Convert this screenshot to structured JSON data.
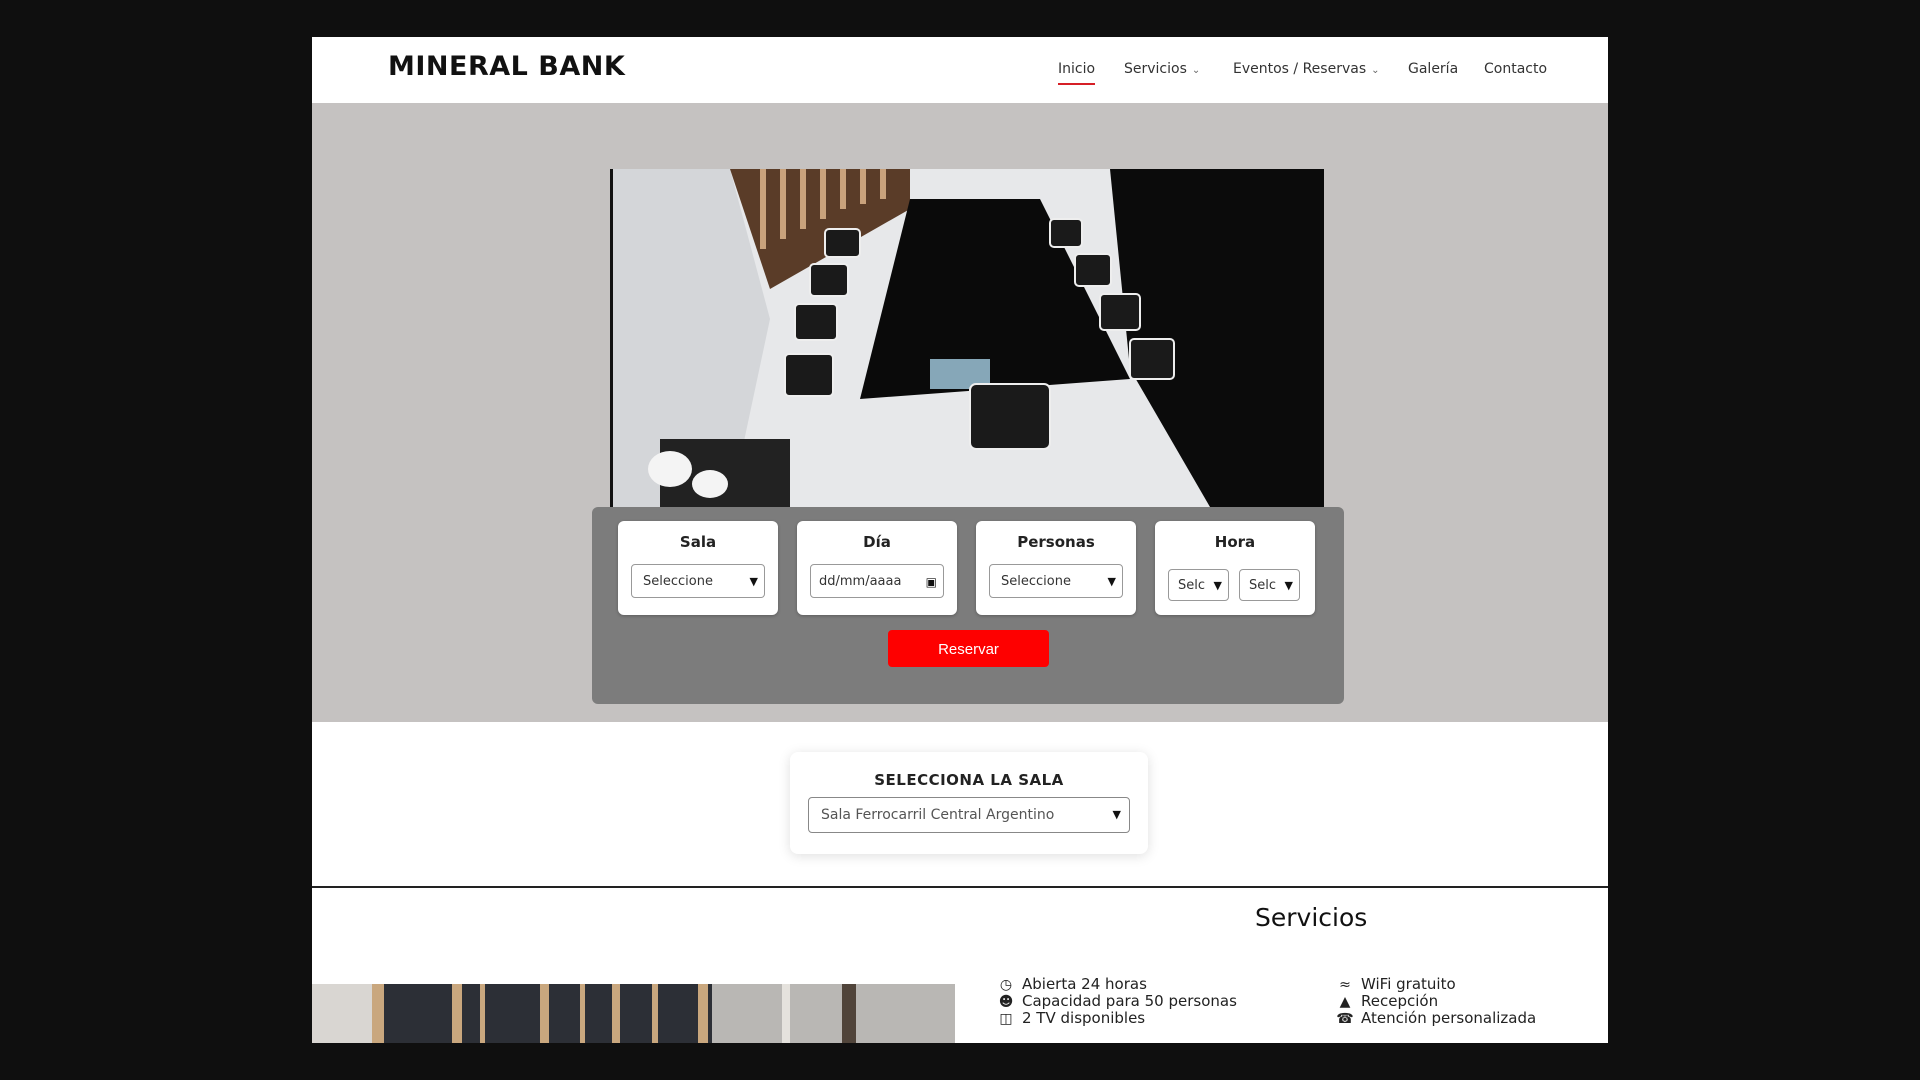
{
  "header": {
    "logo": "MINERAL BANK",
    "nav": [
      {
        "label": "Inicio",
        "active": true
      },
      {
        "label": "Servicios",
        "dropdown": true
      },
      {
        "label": "Eventos / Reservas",
        "dropdown": true
      },
      {
        "label": "Galería"
      },
      {
        "label": "Contacto"
      }
    ]
  },
  "booking": {
    "sala": {
      "title": "Sala",
      "value": "Seleccione"
    },
    "dia": {
      "title": "Día",
      "value": "dd/mm/aaaa"
    },
    "personas": {
      "title": "Personas",
      "value": "Seleccione"
    },
    "hora": {
      "title": "Hora",
      "value_1": "Selc",
      "value_2": "Selc"
    },
    "reserve_label": "Reservar"
  },
  "room_selector": {
    "title": "SELECCIONA LA SALA",
    "selected": "Sala Ferrocarril Central Argentino"
  },
  "services": {
    "title": "Servicios",
    "left": [
      {
        "icon": "clock-icon",
        "label": "Abierta 24 horas"
      },
      {
        "icon": "people-icon",
        "label": "Capacidad para 50 personas"
      },
      {
        "icon": "tv-icon",
        "label": "2 TV disponibles"
      }
    ],
    "right": [
      {
        "icon": "wifi-icon",
        "label": "WiFi gratuito"
      },
      {
        "icon": "reception-bell-icon",
        "label": "Recepción"
      },
      {
        "icon": "headset-icon",
        "label": "Atención personalizada"
      }
    ]
  },
  "colors": {
    "accent": "#fe0000",
    "hero_bg": "#c5c2c1",
    "booking_bg": "#7c7c7c"
  }
}
